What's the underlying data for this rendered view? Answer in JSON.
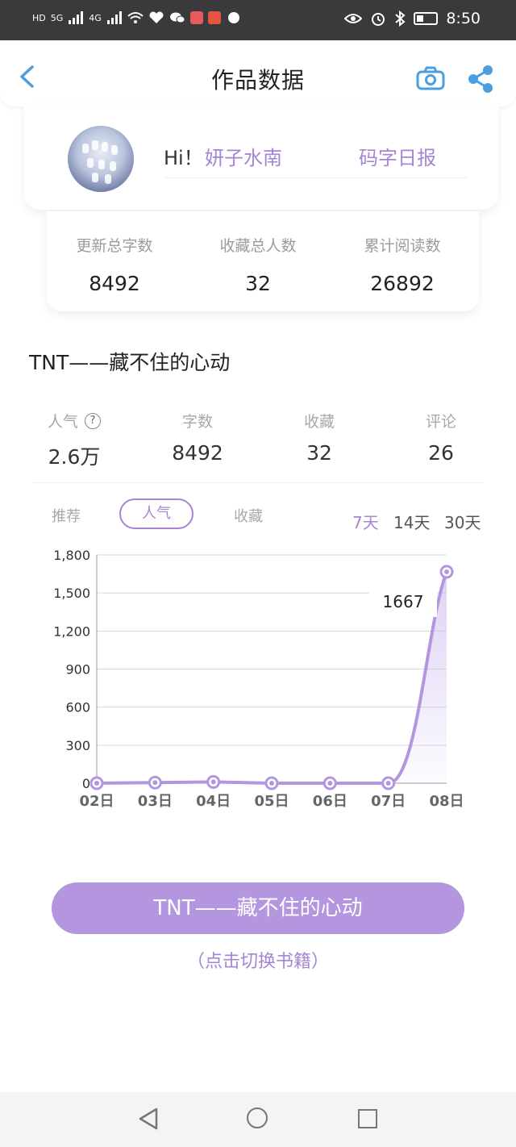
{
  "status_bar": {
    "network_labels": [
      "HD",
      "5G",
      "4G"
    ],
    "time": "8:50",
    "icons": [
      "eye-icon",
      "alarm-icon",
      "bluetooth-icon",
      "battery-icon"
    ]
  },
  "header": {
    "title": "作品数据",
    "back_icon": "chevron-left-icon",
    "camera_icon": "camera-icon",
    "share_icon": "share-icon",
    "accent": "#4a9fe0"
  },
  "profile": {
    "greeting": "Hi！",
    "username": "妍子水南",
    "daily_report_link": "码字日报"
  },
  "summary_stats": [
    {
      "label": "更新总字数",
      "value": "8492"
    },
    {
      "label": "收藏总人数",
      "value": "32"
    },
    {
      "label": "累计阅读数",
      "value": "26892"
    }
  ],
  "book": {
    "title": "TNT——藏不住的心动",
    "metrics": [
      {
        "label": "人气",
        "value": "2.6万",
        "has_help": true,
        "help_glyph": "?"
      },
      {
        "label": "字数",
        "value": "8492"
      },
      {
        "label": "收藏",
        "value": "32"
      },
      {
        "label": "评论",
        "value": "26"
      }
    ]
  },
  "chart_tabs": {
    "items": [
      "推荐",
      "人气",
      "收藏"
    ],
    "active": "人气"
  },
  "range_tabs": {
    "items": [
      "7天",
      "14天",
      "30天"
    ],
    "active": "7天"
  },
  "chart_data": {
    "type": "area",
    "categories": [
      "02日",
      "03日",
      "04日",
      "05日",
      "06日",
      "07日",
      "08日"
    ],
    "series": [
      {
        "values": [
          0,
          5,
          10,
          0,
          0,
          0,
          1667
        ]
      }
    ],
    "highlight_label": "1667",
    "ylim": [
      0,
      1800
    ],
    "yticks": [
      0,
      300,
      600,
      900,
      1200,
      1500,
      1800
    ],
    "ytick_labels": [
      "0",
      "300",
      "600",
      "900",
      "1,200",
      "1,500",
      "1,800"
    ],
    "grid": true,
    "accent": "#b395e0"
  },
  "action": {
    "button_label": "TNT——藏不住的心动",
    "switch_link": "（点击切换书籍）",
    "accent": "#b395e0"
  },
  "system_nav": {
    "icons": [
      "back-triangle-icon",
      "home-circle-icon",
      "recent-square-icon"
    ]
  }
}
